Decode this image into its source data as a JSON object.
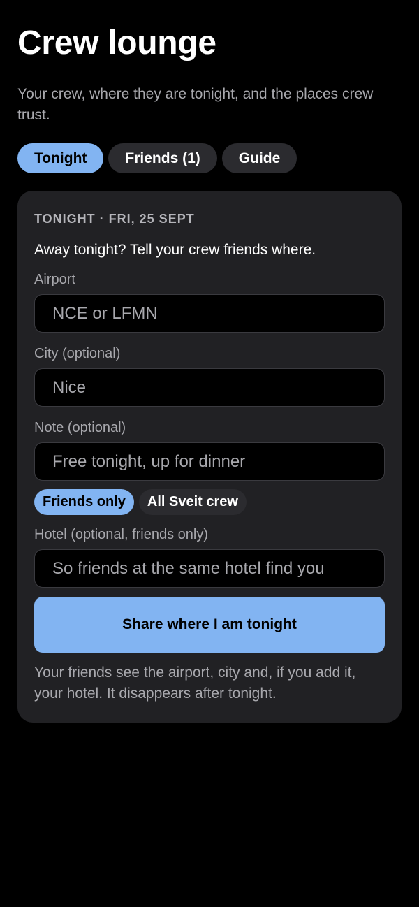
{
  "page": {
    "title": "Crew lounge",
    "subtitle": "Your crew, where they are tonight, and the places crew trust."
  },
  "tabs": [
    {
      "label": "Tonight",
      "active": true
    },
    {
      "label": "Friends (1)",
      "active": false
    },
    {
      "label": "Guide",
      "active": false
    }
  ],
  "card": {
    "eyebrow": "TONIGHT · FRI, 25 SEPT",
    "lead": "Away tonight? Tell your crew friends where.",
    "fields": {
      "airport": {
        "label": "Airport",
        "value": "",
        "placeholder": "NCE or LFMN"
      },
      "city": {
        "label": "City (optional)",
        "value": "",
        "placeholder": "Nice"
      },
      "note": {
        "label": "Note (optional)",
        "value": "",
        "placeholder": "Free tonight, up for dinner"
      },
      "hotel": {
        "label": "Hotel (optional, friends only)",
        "value": "",
        "placeholder": "So friends at the same hotel find you"
      }
    },
    "audience": [
      {
        "label": "Friends only",
        "active": true
      },
      {
        "label": "All Sveit crew",
        "active": false
      }
    ],
    "share_label": "Share where I am tonight",
    "footnote": "Your friends see the airport, city and, if you add it, your hotel. It disappears after tonight."
  },
  "colors": {
    "background": "#000000",
    "card": "#212124",
    "accent": "#82b4f2",
    "muted_text": "#a8a8ad",
    "pill": "#2b2b2f"
  }
}
